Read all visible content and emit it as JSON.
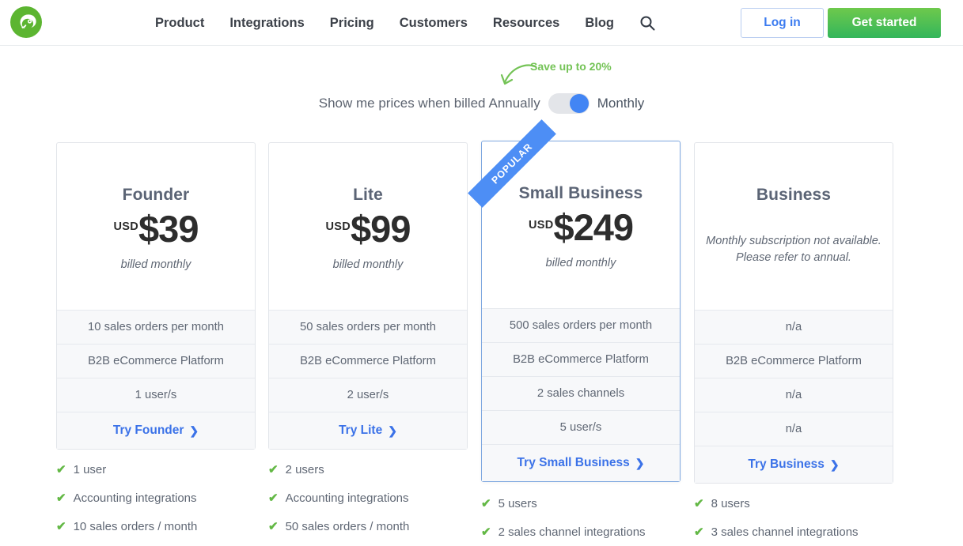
{
  "header": {
    "logo_icon": "chameleon-logo-icon",
    "nav": [
      {
        "label": "Product"
      },
      {
        "label": "Integrations"
      },
      {
        "label": "Pricing"
      },
      {
        "label": "Customers"
      },
      {
        "label": "Resources"
      },
      {
        "label": "Blog"
      }
    ],
    "search_icon": "search-icon",
    "login_label": "Log in",
    "get_started_label": "Get started",
    "accent_green": "#33b65b",
    "accent_blue": "#3b7bf0"
  },
  "billing": {
    "save_note": "Save up to 20%",
    "prefix_label": "Show me prices when billed",
    "annually_label": "Annually",
    "monthly_label": "Monthly",
    "selected": "Monthly",
    "toggle_on_color": "#4285f4",
    "toggle_track_color": "#e3e5e9",
    "save_note_color": "#74c356"
  },
  "plans": [
    {
      "name": "Founder",
      "currency": "USD",
      "price": "$39",
      "price_note": "billed monthly",
      "unavailable_note": null,
      "popular": false,
      "specs": [
        "10 sales orders per month",
        "B2B eCommerce Platform",
        "1 user/s"
      ],
      "cta_label": "Try Founder",
      "features": [
        "1 user",
        "Accounting integrations",
        "10 sales orders / month"
      ]
    },
    {
      "name": "Lite",
      "currency": "USD",
      "price": "$99",
      "price_note": "billed monthly",
      "unavailable_note": null,
      "popular": false,
      "specs": [
        "50 sales orders per month",
        "B2B eCommerce Platform",
        "2 user/s"
      ],
      "cta_label": "Try Lite",
      "features": [
        "2 users",
        "Accounting integrations",
        "50 sales orders / month"
      ]
    },
    {
      "name": "Small Business",
      "currency": "USD",
      "price": "$249",
      "price_note": "billed monthly",
      "unavailable_note": null,
      "popular": true,
      "popular_badge": "POPULAR",
      "specs": [
        "500 sales orders per month",
        "B2B eCommerce Platform",
        "2 sales channels",
        "5 user/s"
      ],
      "cta_label": "Try Small Business",
      "features": [
        "5 users",
        "2 sales channel integrations"
      ]
    },
    {
      "name": "Business",
      "currency": null,
      "price": null,
      "price_note": null,
      "unavailable_note": "Monthly subscription not available. Please refer to annual.",
      "popular": false,
      "specs": [
        "n/a",
        "B2B eCommerce Platform",
        "n/a",
        "n/a"
      ],
      "cta_label": "Try Business",
      "features": [
        "8 users",
        "3 sales channel integrations"
      ]
    }
  ],
  "icons": {
    "chevron": "❯",
    "check": "✔"
  }
}
